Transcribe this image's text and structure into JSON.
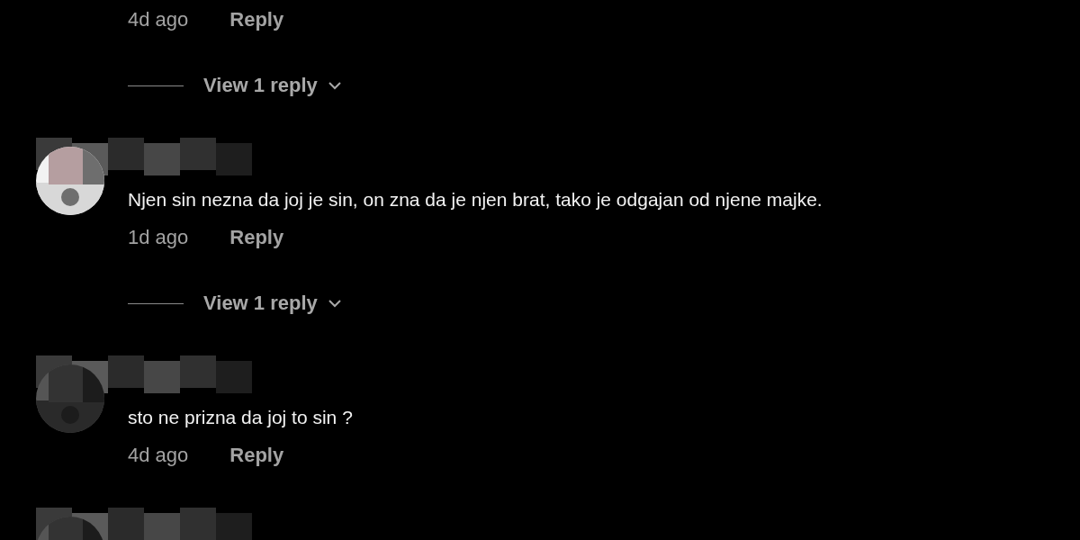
{
  "comments": [
    {
      "kind": "cut-top",
      "time": "4d ago",
      "reply": "Reply",
      "replies_link": "View 1 reply"
    },
    {
      "kind": "full",
      "text": "Njen sin nezna da joj je sin, on zna da je njen brat, tako je odgajan od njene majke.",
      "time": "1d ago",
      "reply": "Reply",
      "replies_link": "View 1 reply"
    },
    {
      "kind": "full",
      "text": "sto ne prizna da joj to sin ?",
      "time": "4d ago",
      "reply": "Reply"
    },
    {
      "kind": "cut-bottom"
    }
  ]
}
